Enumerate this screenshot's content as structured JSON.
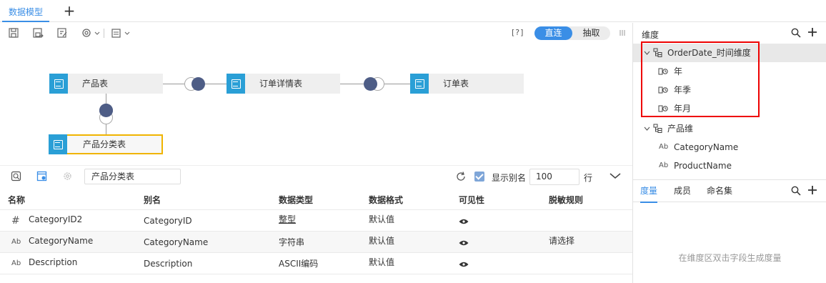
{
  "tabs": {
    "active": "数据模型",
    "add": "+"
  },
  "toolbar": {
    "help": "[?]",
    "mode_direct": "直连",
    "mode_extract": "抽取"
  },
  "diagram": {
    "nodes": [
      "产品表",
      "订单详情表",
      "订单表",
      "产品分类表"
    ]
  },
  "grid": {
    "filter_value": "产品分类表",
    "show_alias_label": "显示别名",
    "rows_value": "100",
    "rows_unit": "行",
    "headers": [
      "名称",
      "别名",
      "数据类型",
      "数据格式",
      "可见性",
      "脱敏规则"
    ],
    "rows": [
      {
        "type_icon": "#",
        "name": "CategoryID2",
        "alias": "CategoryID",
        "dtype": "整型",
        "format": "默认值",
        "rule": ""
      },
      {
        "type_icon": "Ab",
        "name": "CategoryName",
        "alias": "CategoryName",
        "dtype": "字符串",
        "format": "默认值",
        "rule": "请选择"
      },
      {
        "type_icon": "Ab",
        "name": "Description",
        "alias": "Description",
        "dtype": "ASCII编码",
        "format": "默认值",
        "rule": ""
      }
    ]
  },
  "right_panel": {
    "dim_title": "维度",
    "tree": [
      {
        "label": "OrderDate_时间维度",
        "level": 0,
        "icon": "hierarchy-icon",
        "selected": true
      },
      {
        "label": "年",
        "level": 1,
        "icon": "date-icon"
      },
      {
        "label": "年季",
        "level": 1,
        "icon": "date-icon"
      },
      {
        "label": "年月",
        "level": 1,
        "icon": "date-icon"
      },
      {
        "label": "产品维",
        "level": 0,
        "icon": "hierarchy-icon"
      },
      {
        "label": "CategoryName",
        "level": 1,
        "icon": "text-field-icon"
      },
      {
        "label": "ProductName",
        "level": 1,
        "icon": "text-field-icon"
      }
    ],
    "measure_tabs": [
      "度量",
      "成员",
      "命名集"
    ],
    "measure_empty": "在维度区双击字段生成度量"
  },
  "colors": {
    "accent": "#3a8ee6",
    "node_icon": "#2a9fd6",
    "join_fill": "#4e5d86",
    "highlight": "#e00000",
    "selected_node_border": "#f0b400"
  }
}
